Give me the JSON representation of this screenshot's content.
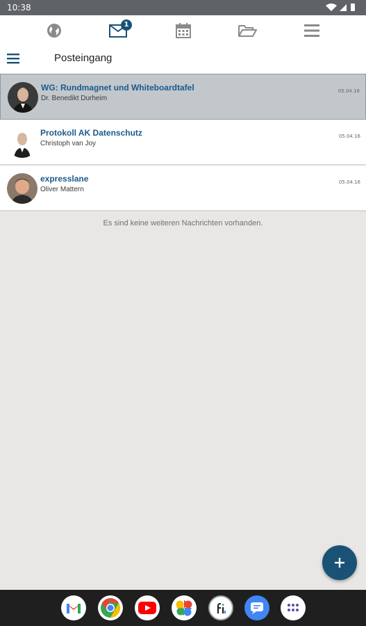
{
  "status_bar": {
    "time": "10:38"
  },
  "topnav": {
    "items": [
      {
        "name": "globe"
      },
      {
        "name": "mail",
        "badge": "1"
      },
      {
        "name": "calendar"
      },
      {
        "name": "folder"
      },
      {
        "name": "menu"
      }
    ]
  },
  "header": {
    "title": "Posteingang"
  },
  "messages": [
    {
      "subject": "WG: Rundmagnet und Whiteboardtafel",
      "sender": "Dr. Benedikt Durheim",
      "date": "05.04.16",
      "selected": true
    },
    {
      "subject": "Protokoll AK Datenschutz",
      "sender": "Christoph van Joy",
      "date": "05.04.16",
      "selected": false
    },
    {
      "subject": "expresslane",
      "sender": "Oliver Mattern",
      "date": "05.04.16",
      "selected": false
    }
  ],
  "empty_note": "Es sind keine weiteren Nachrichten vorhanden.",
  "fab": {
    "icon": "plus-icon"
  },
  "dock": {
    "apps": [
      "gmail",
      "chrome",
      "youtube",
      "photos",
      "fi-app",
      "messages",
      "app-drawer"
    ]
  },
  "colors": {
    "accent": "#1a5276",
    "subject": "#1b5a8c",
    "selected_row": "#c2c7cc",
    "background": "#e9e7e6"
  }
}
